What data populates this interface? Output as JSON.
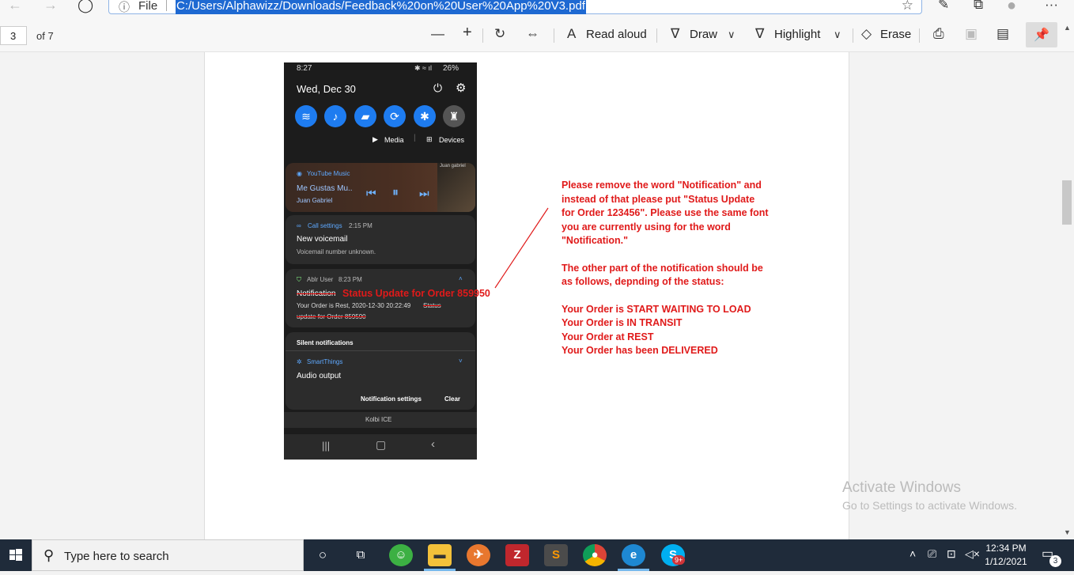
{
  "browser": {
    "info_label": "File",
    "url": "C:/Users/Alphawizz/Downloads/Feedback%20on%20User%20App%20V3.pdf"
  },
  "pdf_toolbar": {
    "page_number": "3",
    "page_total": "of 7",
    "read_aloud": "Read aloud",
    "draw": "Draw",
    "highlight": "Highlight",
    "erase": "Erase"
  },
  "phone": {
    "status_time": "8:27",
    "battery": "26%",
    "date": "Wed, Dec 30",
    "media_label": "Media",
    "devices_label": "Devices",
    "music": {
      "app": "YouTube Music",
      "title": "Me Gustas Mu..",
      "artist": "Juan Gabriel",
      "cover_text": "Juan gabriel"
    },
    "voicemail": {
      "app": "Call settings",
      "time": "2:15 PM",
      "title": "New voicemail",
      "body": "Voicemail number unknown."
    },
    "ablr": {
      "app": "Ablr User",
      "time": "8:23 PM",
      "struck_title": "Notification",
      "annotation": "Status Update for Order 859950",
      "body": "Your Order is Rest, 2020-12-30 20:22:49",
      "struck_body_1": "Status",
      "struck_body_2": "update for Order 859590"
    },
    "silent_header": "Silent notifications",
    "smartthings": {
      "app": "SmartThings",
      "title": "Audio output"
    },
    "notif_settings": "Notification settings",
    "clear": "Clear",
    "carrier": "Kolbi ICE"
  },
  "notes": {
    "lines_1": [
      "Please remove the word \"Notification\" and",
      "instead of that please put \"Status Update",
      "for Order 123456\". Please use the same font",
      "you are currently using for the word",
      "\"Notification.\""
    ],
    "lines_2": [
      "The other part of the notification should be",
      "as follows, depnding of the status:"
    ],
    "lines_3": [
      "Your Order is START WAITING TO LOAD",
      "Your Order is IN TRANSIT",
      "Your Order at REST",
      "Your Order has been DELIVERED"
    ]
  },
  "watermark": {
    "title": "Activate Windows",
    "subtitle": "Go to Settings to activate Windows."
  },
  "taskbar": {
    "search_placeholder": "Type here to search",
    "time": "12:34 PM",
    "date": "1/12/2021",
    "notification_count": "3",
    "skype_badge": "9+"
  }
}
